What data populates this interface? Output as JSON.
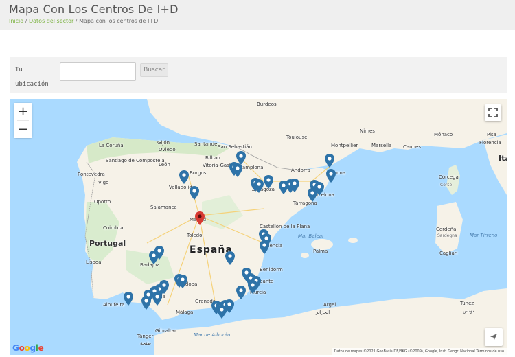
{
  "header": {
    "title": "Mapa Con Los Centros De I+D",
    "breadcrumb": {
      "home": "Inicio",
      "section": "Datos del sector",
      "current": "Mapa con los centros de I+D",
      "separator": "/"
    }
  },
  "search": {
    "location_label": "Tu ubicación",
    "input_value": "",
    "button_label": "Buscar"
  },
  "map": {
    "zoom_in": "+",
    "zoom_out": "−",
    "logo": "Google",
    "attribution": "Datos de mapas ©2021 GeoBasis-DE/BKG (©2009), Google, Inst. Geogr. Nacional   Términos de uso",
    "colors": {
      "water": "#aadaff",
      "land": "#f6f2e8",
      "green": "#cfe6c1",
      "pin_blue": "#2e73a8",
      "pin_red": "#d73a32"
    },
    "labels": [
      {
        "text": "Burdeos",
        "cls": ""
      },
      {
        "text": "Toulouse",
        "cls": ""
      },
      {
        "text": "Nimes",
        "cls": ""
      },
      {
        "text": "Montpellier",
        "cls": ""
      },
      {
        "text": "Marsella",
        "cls": ""
      },
      {
        "text": "Cannes",
        "cls": ""
      },
      {
        "text": "Mónaco",
        "cls": ""
      },
      {
        "text": "Pisa",
        "cls": ""
      },
      {
        "text": "Florencia",
        "cls": ""
      },
      {
        "text": "Ita",
        "cls": "country"
      },
      {
        "text": "Andorra",
        "cls": ""
      },
      {
        "text": "Girona",
        "cls": ""
      },
      {
        "text": "Barcelona",
        "cls": ""
      },
      {
        "text": "Tarragona",
        "cls": ""
      },
      {
        "text": "Córcega",
        "cls": ""
      },
      {
        "text": "Corse",
        "cls": "region"
      },
      {
        "text": "Cerdeña",
        "cls": ""
      },
      {
        "text": "Sardegna",
        "cls": "region"
      },
      {
        "text": "Cagliari",
        "cls": ""
      },
      {
        "text": "Mar Tirreno",
        "cls": "sea"
      },
      {
        "text": "Gijón",
        "cls": ""
      },
      {
        "text": "Oviedo",
        "cls": ""
      },
      {
        "text": "Santander",
        "cls": ""
      },
      {
        "text": "San Sebastián",
        "cls": ""
      },
      {
        "text": "Bilbao",
        "cls": ""
      },
      {
        "text": "Vitoria-Gasteiz",
        "cls": ""
      },
      {
        "text": "Pamplona",
        "cls": ""
      },
      {
        "text": "La Coruña",
        "cls": ""
      },
      {
        "text": "Santiago de Compostela",
        "cls": ""
      },
      {
        "text": "Pontevedra",
        "cls": ""
      },
      {
        "text": "Vigo",
        "cls": ""
      },
      {
        "text": "León",
        "cls": ""
      },
      {
        "text": "Burgos",
        "cls": ""
      },
      {
        "text": "Valladolid",
        "cls": ""
      },
      {
        "text": "Zaragoza",
        "cls": ""
      },
      {
        "text": "Oporto",
        "cls": ""
      },
      {
        "text": "Salamanca",
        "cls": ""
      },
      {
        "text": "Madrid",
        "cls": ""
      },
      {
        "text": "Coimbra",
        "cls": ""
      },
      {
        "text": "Portugal",
        "cls": "country"
      },
      {
        "text": "Toledo",
        "cls": ""
      },
      {
        "text": "España",
        "cls": "country-big"
      },
      {
        "text": "Castellón de la Plana",
        "cls": ""
      },
      {
        "text": "Valencia",
        "cls": ""
      },
      {
        "text": "Palma",
        "cls": ""
      },
      {
        "text": "Mar Balear",
        "cls": "sea"
      },
      {
        "text": "Lisboa",
        "cls": ""
      },
      {
        "text": "Badajoz",
        "cls": ""
      },
      {
        "text": "Córdoba",
        "cls": ""
      },
      {
        "text": "Benidorm",
        "cls": ""
      },
      {
        "text": "Alicante",
        "cls": ""
      },
      {
        "text": "Murcia",
        "cls": ""
      },
      {
        "text": "Albufeira",
        "cls": ""
      },
      {
        "text": "Sevilla",
        "cls": ""
      },
      {
        "text": "Granada",
        "cls": ""
      },
      {
        "text": "Málaga",
        "cls": ""
      },
      {
        "text": "Mar de Alborán",
        "cls": "sea"
      },
      {
        "text": "Gibraltar",
        "cls": ""
      },
      {
        "text": "Tánger",
        "cls": ""
      },
      {
        "text": "طنجة",
        "cls": ""
      },
      {
        "text": "Argel",
        "cls": ""
      },
      {
        "text": "الجزائر",
        "cls": ""
      },
      {
        "text": "Túnez",
        "cls": ""
      },
      {
        "text": "تونس",
        "cls": ""
      }
    ]
  }
}
